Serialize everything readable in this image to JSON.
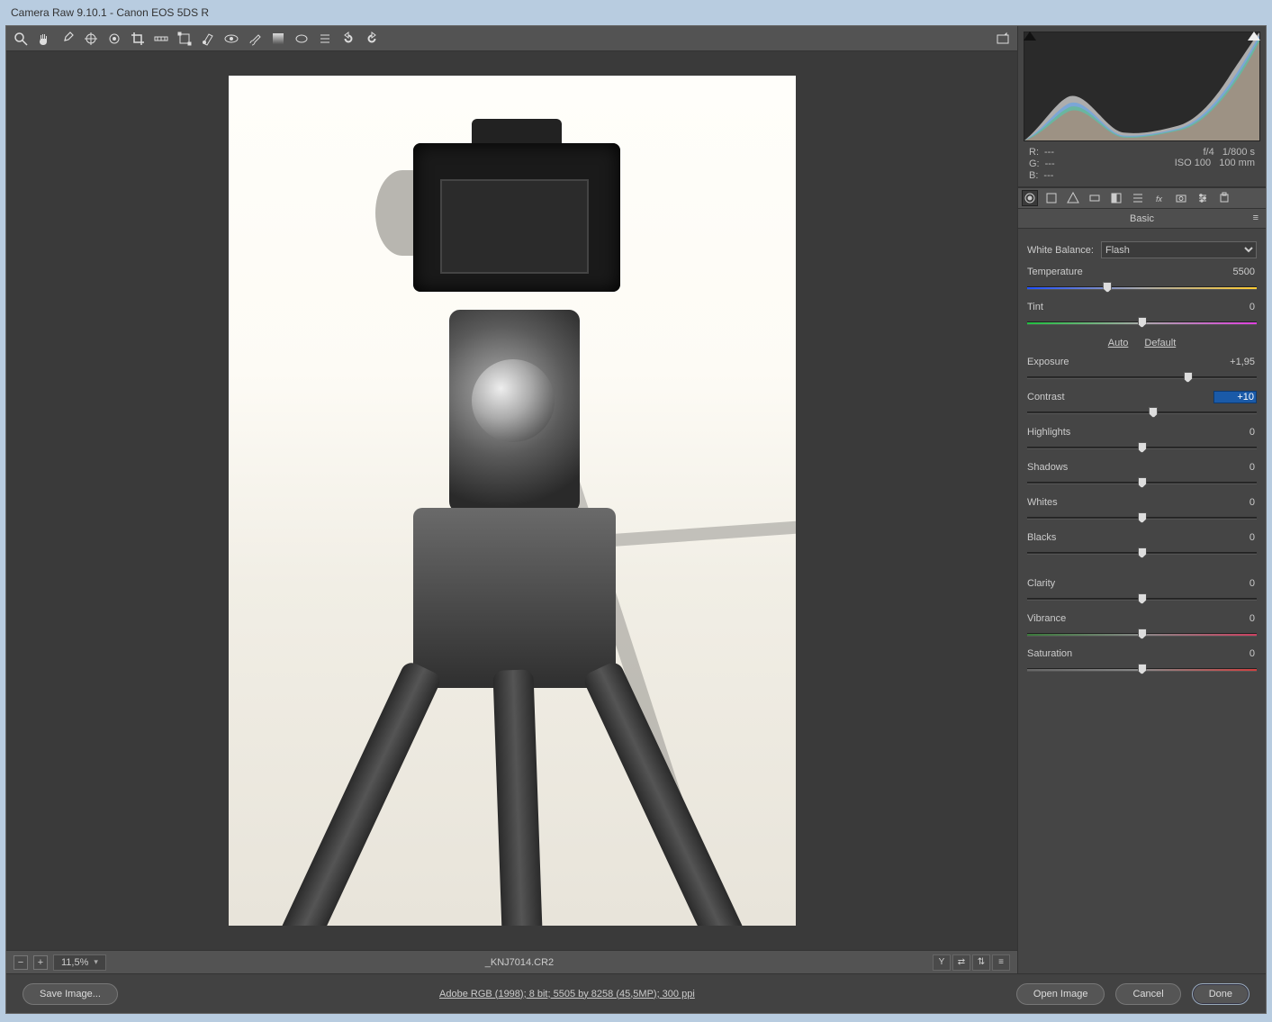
{
  "window": {
    "title": "Camera Raw 9.10.1  -  Canon EOS 5DS R"
  },
  "toolbar": {
    "tools": [
      "zoom",
      "hand",
      "white-balance",
      "color-sampler",
      "target-adjust",
      "crop",
      "straighten",
      "transform",
      "spot-removal",
      "red-eye",
      "adjustment-brush",
      "graduated-filter",
      "radial-filter",
      "preferences",
      "rotate-ccw",
      "rotate-cw"
    ]
  },
  "preview": {
    "filename": "_KNJ7014.CR2",
    "zoom": "11,5%"
  },
  "readout": {
    "r": "---",
    "g": "---",
    "b": "---",
    "aperture": "f/4",
    "shutter": "1/800 s",
    "iso": "ISO 100",
    "focal": "100 mm"
  },
  "panel": {
    "title": "Basic",
    "tabs": [
      "basic",
      "tone-curve",
      "detail",
      "hsl",
      "split-toning",
      "lens-corrections",
      "effects",
      "camera-calibration",
      "presets",
      "snapshots"
    ],
    "wb_label": "White Balance:",
    "wb_value": "Flash",
    "auto": "Auto",
    "default": "Default",
    "sliders": {
      "temperature": {
        "label": "Temperature",
        "value": "5500",
        "pos": 35
      },
      "tint": {
        "label": "Tint",
        "value": "0",
        "pos": 50
      },
      "exposure": {
        "label": "Exposure",
        "value": "+1,95",
        "pos": 70
      },
      "contrast": {
        "label": "Contrast",
        "value": "+10",
        "pos": 55,
        "boxed": true
      },
      "highlights": {
        "label": "Highlights",
        "value": "0",
        "pos": 50
      },
      "shadows": {
        "label": "Shadows",
        "value": "0",
        "pos": 50
      },
      "whites": {
        "label": "Whites",
        "value": "0",
        "pos": 50
      },
      "blacks": {
        "label": "Blacks",
        "value": "0",
        "pos": 50
      },
      "clarity": {
        "label": "Clarity",
        "value": "0",
        "pos": 50
      },
      "vibrance": {
        "label": "Vibrance",
        "value": "0",
        "pos": 50
      },
      "saturation": {
        "label": "Saturation",
        "value": "0",
        "pos": 50
      }
    }
  },
  "footer": {
    "save_image": "Save Image...",
    "workflow": "Adobe RGB (1998); 8 bit; 5505 by 8258 (45,5MP); 300 ppi",
    "open_image": "Open Image",
    "cancel": "Cancel",
    "done": "Done"
  }
}
